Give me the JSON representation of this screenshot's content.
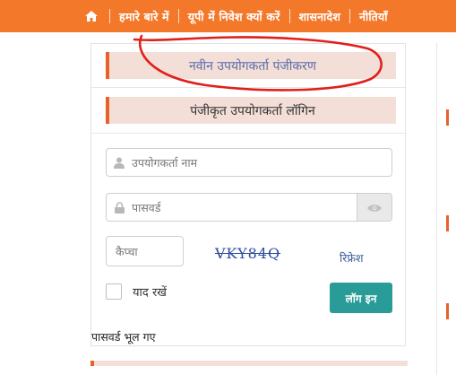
{
  "nav": {
    "items": [
      "हमारे बारे में",
      "यूपी में निवेश क्यों करें",
      "शासनादेश",
      "नीतियाँ"
    ]
  },
  "tabs": {
    "new_registration": "नवीन उपयोगकर्ता पंजीकरण",
    "registered_login": "पंजीकृत उपयोगकर्ता लॉगिन"
  },
  "form": {
    "username_placeholder": "उपयोगकर्ता नाम",
    "password_placeholder": "पासवर्ड",
    "captcha_placeholder": "कैप्चा",
    "captcha_code": "VKY84Q",
    "refresh_label": "रिफ्रेश",
    "remember_label": "याद रखें",
    "login_label": "लॉग इन",
    "forgot_password": "पासवर्ड भूल गए"
  },
  "icons": [
    "home-icon",
    "user-icon",
    "lock-icon",
    "eye-icon"
  ],
  "colors": {
    "nav_bg": "#f4782a",
    "accent": "#e8602a",
    "tab_bg": "#f4dfd8",
    "login_button": "#2a9c98",
    "annotation": "#e0201a"
  }
}
